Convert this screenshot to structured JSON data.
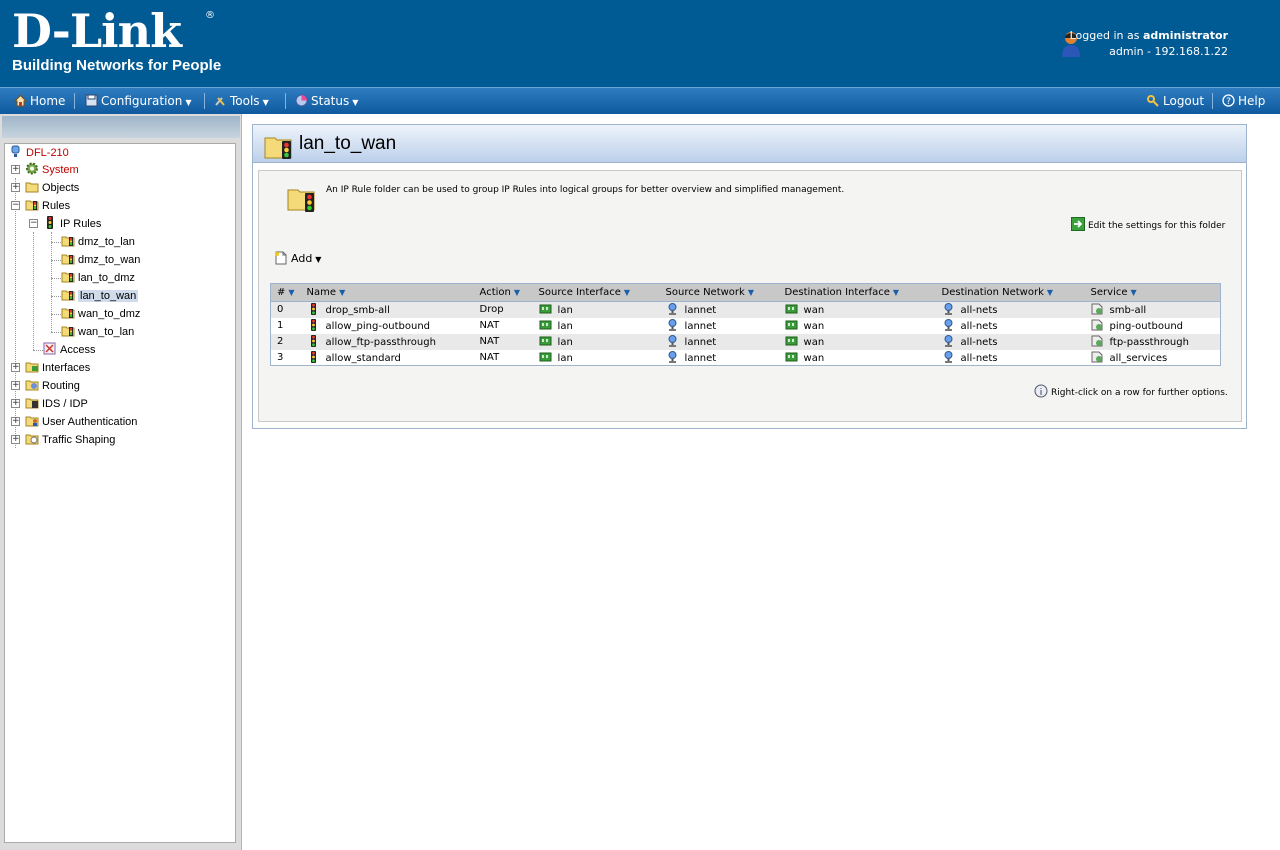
{
  "header": {
    "brand": "D-Link",
    "tagline": "Building Networks for People",
    "logged_in_prefix": "Logged in as",
    "user": "administrator",
    "session": "admin - 192.168.1.22"
  },
  "menu": {
    "home": "Home",
    "configuration": "Configuration",
    "tools": "Tools",
    "status": "Status",
    "logout": "Logout",
    "help": "Help"
  },
  "tree": {
    "device": "DFL-210",
    "system": "System",
    "objects": "Objects",
    "rules": "Rules",
    "ip_rules": "IP Rules",
    "folders": [
      "dmz_to_lan",
      "dmz_to_wan",
      "lan_to_dmz",
      "lan_to_wan",
      "wan_to_dmz",
      "wan_to_lan"
    ],
    "access": "Access",
    "interfaces": "Interfaces",
    "routing": "Routing",
    "ids_idp": "IDS / IDP",
    "user_auth": "User Authentication",
    "traffic_shaping": "Traffic Shaping"
  },
  "panel": {
    "title": "lan_to_wan",
    "description": "An IP Rule folder can be used to group IP Rules into logical groups for better overview and simplified management.",
    "edit_link": "Edit the settings for this folder",
    "add": "Add",
    "hint": "Right-click on a row for further options."
  },
  "table": {
    "columns": [
      "#",
      "Name",
      "Action",
      "Source Interface",
      "Source Network",
      "Destination Interface",
      "Destination Network",
      "Service"
    ],
    "rows": [
      [
        "0",
        "drop_smb-all",
        "Drop",
        "lan",
        "lannet",
        "wan",
        "all-nets",
        "smb-all"
      ],
      [
        "1",
        "allow_ping-outbound",
        "NAT",
        "lan",
        "lannet",
        "wan",
        "all-nets",
        "ping-outbound"
      ],
      [
        "2",
        "allow_ftp-passthrough",
        "NAT",
        "lan",
        "lannet",
        "wan",
        "all-nets",
        "ftp-passthrough"
      ],
      [
        "3",
        "allow_standard",
        "NAT",
        "lan",
        "lannet",
        "wan",
        "all-nets",
        "all_services"
      ]
    ]
  },
  "colors": {
    "header": "#005a94",
    "menubar": "#1565a8",
    "device_text": "#c00000"
  }
}
